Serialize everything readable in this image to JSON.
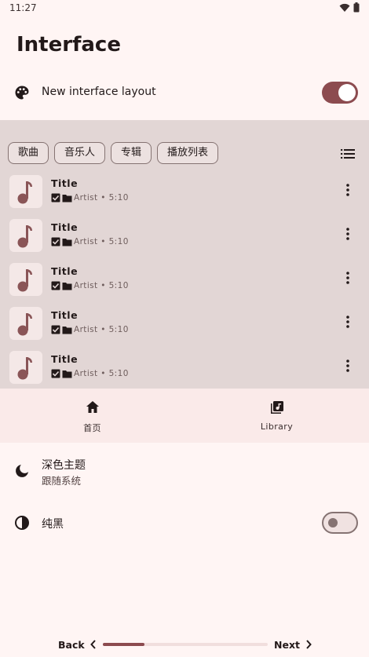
{
  "status_bar": {
    "time": "11:27"
  },
  "page": {
    "title": "Interface"
  },
  "settings": {
    "new_layout": {
      "label": "New interface layout",
      "enabled": true
    },
    "dark_theme": {
      "label": "深色主题",
      "value": "跟随系统"
    },
    "pure_black": {
      "label": "纯黑",
      "enabled": false
    }
  },
  "preview": {
    "chips": [
      "歌曲",
      "音乐人",
      "专辑",
      "播放列表"
    ],
    "songs": [
      {
        "title": "Title",
        "meta": "Artist • 5:10"
      },
      {
        "title": "Title",
        "meta": "Artist • 5:10"
      },
      {
        "title": "Title",
        "meta": "Artist • 5:10"
      },
      {
        "title": "Title",
        "meta": "Artist • 5:10"
      },
      {
        "title": "Title",
        "meta": "Artist • 5:10"
      }
    ],
    "nav": [
      {
        "label": "首页",
        "icon": "home-icon"
      },
      {
        "label": "Library",
        "icon": "library-music-icon"
      }
    ]
  },
  "pager": {
    "back_label": "Back",
    "next_label": "Next",
    "progress": 0.25
  },
  "colors": {
    "accent": "#8c4b4f",
    "background": "#fff5f4",
    "preview_bg": "#e2d6d5"
  }
}
